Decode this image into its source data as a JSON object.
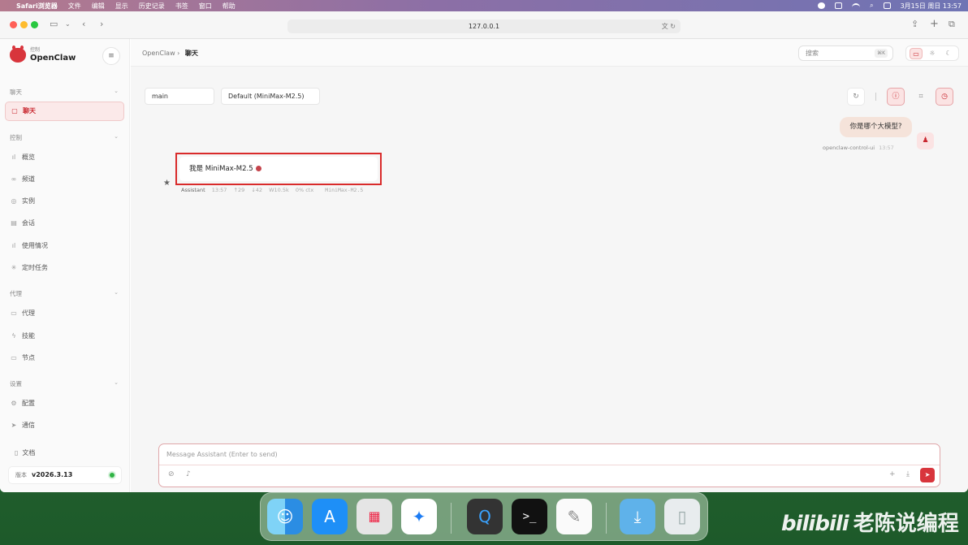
{
  "menubar": {
    "app": "Safari浏览器",
    "items": [
      "文件",
      "编辑",
      "显示",
      "历史记录",
      "书签",
      "窗口",
      "帮助"
    ],
    "datetime": "3月15日 周日 13:57"
  },
  "browser": {
    "url": "127.0.0.1"
  },
  "sidebar": {
    "brand_sub": "控制",
    "brand_name": "OpenClaw",
    "sections": [
      {
        "label": "聊天",
        "items": [
          {
            "label": "聊天",
            "icon": "chat-bubble-icon"
          }
        ]
      },
      {
        "label": "控制",
        "items": [
          {
            "label": "概览",
            "icon": "bar-chart-icon"
          },
          {
            "label": "频道",
            "icon": "link-icon"
          },
          {
            "label": "实例",
            "icon": "radio-icon"
          },
          {
            "label": "会话",
            "icon": "document-icon"
          },
          {
            "label": "使用情况",
            "icon": "bar-chart-icon"
          },
          {
            "label": "定时任务",
            "icon": "loader-icon"
          }
        ]
      },
      {
        "label": "代理",
        "items": [
          {
            "label": "代理",
            "icon": "folder-icon"
          },
          {
            "label": "技能",
            "icon": "lightning-icon"
          },
          {
            "label": "节点",
            "icon": "monitor-icon"
          }
        ]
      },
      {
        "label": "设置",
        "items": [
          {
            "label": "配置",
            "icon": "gear-icon"
          },
          {
            "label": "通信",
            "icon": "send-icon"
          }
        ]
      }
    ],
    "docs": "文档",
    "version_label": "版本",
    "version": "v2026.3.13"
  },
  "header": {
    "crumb_root": "OpenClaw",
    "crumb_current": "聊天",
    "search_placeholder": "搜索",
    "search_kbd": "⌘K"
  },
  "chat": {
    "session": "main",
    "model": "Default (MiniMax-M2.5)",
    "user_message": "你是哪个大模型?",
    "user_name": "openclaw-control-ui",
    "user_time": "13:57",
    "assistant_message": "我是 MiniMax-M2.5",
    "assistant_name": "Assistant",
    "assistant_time": "13:57",
    "stats": [
      "↑29",
      "↓42",
      "W10.5k",
      "0% ctx"
    ],
    "assistant_model": "MiniMax-M2.5",
    "composer_placeholder": "Message Assistant (Enter to send)"
  },
  "watermark": {
    "logo": "bilibili",
    "text": "老陈说编程"
  },
  "colors": {
    "accent": "#d8353c",
    "highlight": "#d92b2b"
  }
}
